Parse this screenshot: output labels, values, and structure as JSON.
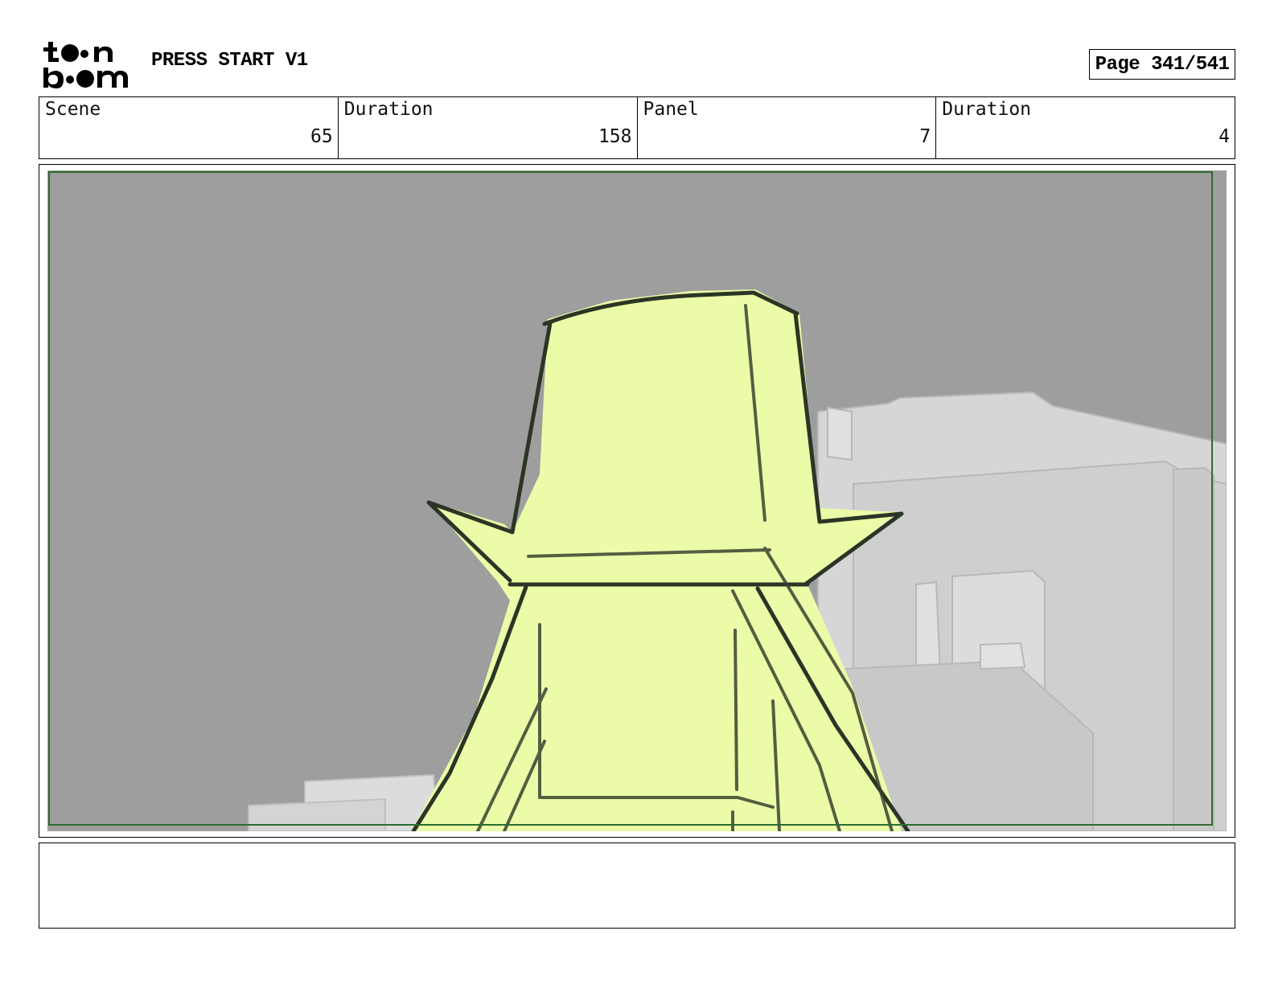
{
  "header": {
    "logo_line1": "toon",
    "logo_line2": "boom",
    "project_title": "PRESS START V1",
    "page_label": "Page 341/541"
  },
  "info": [
    {
      "label": "Scene",
      "value": "65"
    },
    {
      "label": "Duration",
      "value": "158"
    },
    {
      "label": "Panel",
      "value": "7"
    },
    {
      "label": "Duration",
      "value": "4"
    }
  ],
  "panel": {
    "background_color": "#9e9e9e",
    "frame_color": "#2e6b2e",
    "tower_fill_color": "#ecfba8",
    "line_color": "#2b3525",
    "building_color": "#d6d6d6"
  },
  "notes": {
    "text": ""
  }
}
